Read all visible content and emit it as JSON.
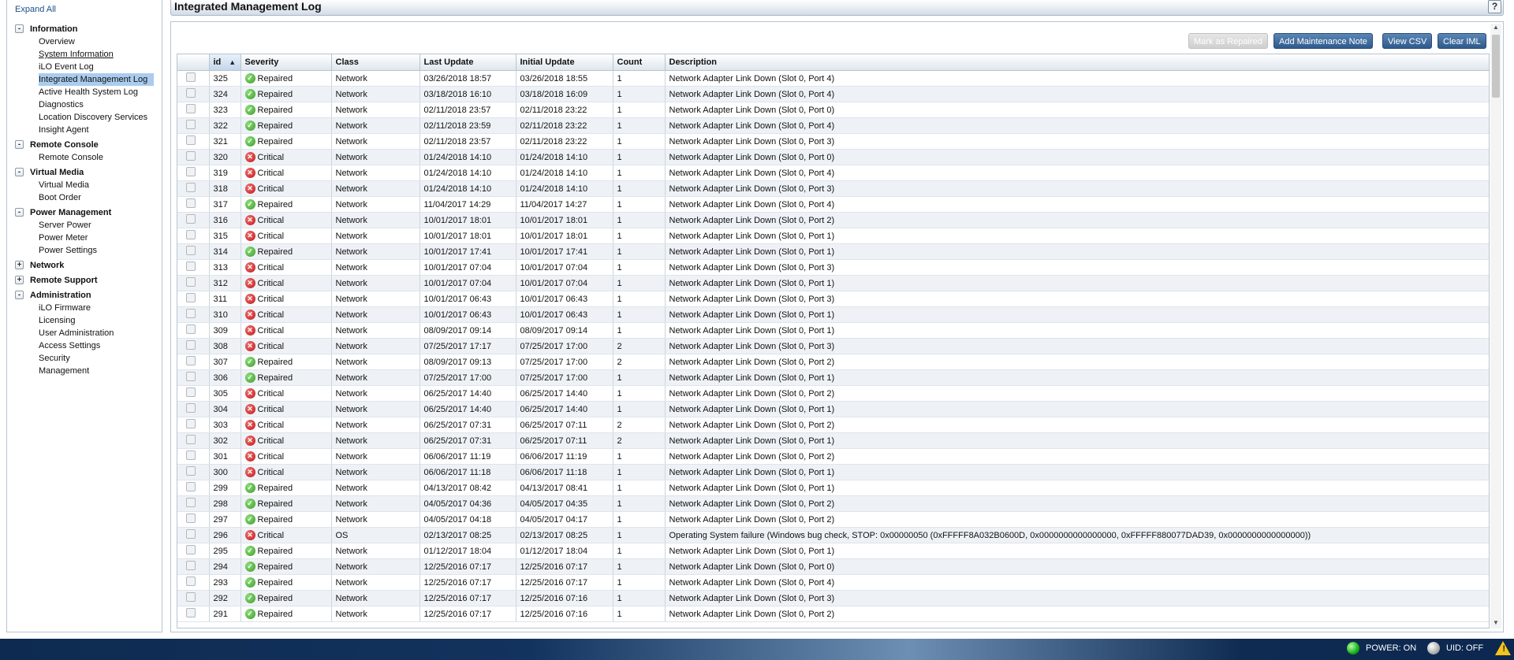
{
  "sidebar": {
    "expand_all": "Expand All",
    "sections": [
      {
        "label": "Information",
        "toggle": "-",
        "items": [
          "Overview",
          "System Information",
          "iLO Event Log",
          "Integrated Management Log",
          "Active Health System Log",
          "Diagnostics",
          "Location Discovery Services",
          "Insight Agent"
        ]
      },
      {
        "label": "Remote Console",
        "toggle": "-",
        "items": [
          "Remote Console"
        ]
      },
      {
        "label": "Virtual Media",
        "toggle": "-",
        "items": [
          "Virtual Media",
          "Boot Order"
        ]
      },
      {
        "label": "Power Management",
        "toggle": "-",
        "items": [
          "Server Power",
          "Power Meter",
          "Power Settings"
        ]
      },
      {
        "label": "Network",
        "toggle": "+",
        "items": []
      },
      {
        "label": "Remote Support",
        "toggle": "+",
        "items": []
      },
      {
        "label": "Administration",
        "toggle": "-",
        "items": [
          "iLO Firmware",
          "Licensing",
          "User Administration",
          "Access Settings",
          "Security",
          "Management"
        ]
      }
    ],
    "active_item": "Integrated Management Log",
    "underlined_item": "System Information"
  },
  "header": {
    "title": "Integrated Management Log",
    "help": "?"
  },
  "toolbar": {
    "mark_repaired": "Mark as Repaired",
    "add_note": "Add Maintenance Note",
    "view_csv": "View CSV",
    "clear_iml": "Clear IML"
  },
  "table": {
    "columns": [
      "id",
      "Severity",
      "Class",
      "Last Update",
      "Initial Update",
      "Count",
      "Description"
    ],
    "sorted_column": "id",
    "rows": [
      [
        "325",
        "Repaired",
        "Network",
        "03/26/2018 18:57",
        "03/26/2018 18:55",
        "1",
        "Network Adapter Link Down (Slot 0, Port 4)"
      ],
      [
        "324",
        "Repaired",
        "Network",
        "03/18/2018 16:10",
        "03/18/2018 16:09",
        "1",
        "Network Adapter Link Down (Slot 0, Port 4)"
      ],
      [
        "323",
        "Repaired",
        "Network",
        "02/11/2018 23:57",
        "02/11/2018 23:22",
        "1",
        "Network Adapter Link Down (Slot 0, Port 0)"
      ],
      [
        "322",
        "Repaired",
        "Network",
        "02/11/2018 23:59",
        "02/11/2018 23:22",
        "1",
        "Network Adapter Link Down (Slot 0, Port 4)"
      ],
      [
        "321",
        "Repaired",
        "Network",
        "02/11/2018 23:57",
        "02/11/2018 23:22",
        "1",
        "Network Adapter Link Down (Slot 0, Port 3)"
      ],
      [
        "320",
        "Critical",
        "Network",
        "01/24/2018 14:10",
        "01/24/2018 14:10",
        "1",
        "Network Adapter Link Down (Slot 0, Port 0)"
      ],
      [
        "319",
        "Critical",
        "Network",
        "01/24/2018 14:10",
        "01/24/2018 14:10",
        "1",
        "Network Adapter Link Down (Slot 0, Port 4)"
      ],
      [
        "318",
        "Critical",
        "Network",
        "01/24/2018 14:10",
        "01/24/2018 14:10",
        "1",
        "Network Adapter Link Down (Slot 0, Port 3)"
      ],
      [
        "317",
        "Repaired",
        "Network",
        "11/04/2017 14:29",
        "11/04/2017 14:27",
        "1",
        "Network Adapter Link Down (Slot 0, Port 4)"
      ],
      [
        "316",
        "Critical",
        "Network",
        "10/01/2017 18:01",
        "10/01/2017 18:01",
        "1",
        "Network Adapter Link Down (Slot 0, Port 2)"
      ],
      [
        "315",
        "Critical",
        "Network",
        "10/01/2017 18:01",
        "10/01/2017 18:01",
        "1",
        "Network Adapter Link Down (Slot 0, Port 1)"
      ],
      [
        "314",
        "Repaired",
        "Network",
        "10/01/2017 17:41",
        "10/01/2017 17:41",
        "1",
        "Network Adapter Link Down (Slot 0, Port 1)"
      ],
      [
        "313",
        "Critical",
        "Network",
        "10/01/2017 07:04",
        "10/01/2017 07:04",
        "1",
        "Network Adapter Link Down (Slot 0, Port 3)"
      ],
      [
        "312",
        "Critical",
        "Network",
        "10/01/2017 07:04",
        "10/01/2017 07:04",
        "1",
        "Network Adapter Link Down (Slot 0, Port 1)"
      ],
      [
        "311",
        "Critical",
        "Network",
        "10/01/2017 06:43",
        "10/01/2017 06:43",
        "1",
        "Network Adapter Link Down (Slot 0, Port 3)"
      ],
      [
        "310",
        "Critical",
        "Network",
        "10/01/2017 06:43",
        "10/01/2017 06:43",
        "1",
        "Network Adapter Link Down (Slot 0, Port 1)"
      ],
      [
        "309",
        "Critical",
        "Network",
        "08/09/2017 09:14",
        "08/09/2017 09:14",
        "1",
        "Network Adapter Link Down (Slot 0, Port 1)"
      ],
      [
        "308",
        "Critical",
        "Network",
        "07/25/2017 17:17",
        "07/25/2017 17:00",
        "2",
        "Network Adapter Link Down (Slot 0, Port 3)"
      ],
      [
        "307",
        "Repaired",
        "Network",
        "08/09/2017 09:13",
        "07/25/2017 17:00",
        "2",
        "Network Adapter Link Down (Slot 0, Port 2)"
      ],
      [
        "306",
        "Repaired",
        "Network",
        "07/25/2017 17:00",
        "07/25/2017 17:00",
        "1",
        "Network Adapter Link Down (Slot 0, Port 1)"
      ],
      [
        "305",
        "Critical",
        "Network",
        "06/25/2017 14:40",
        "06/25/2017 14:40",
        "1",
        "Network Adapter Link Down (Slot 0, Port 2)"
      ],
      [
        "304",
        "Critical",
        "Network",
        "06/25/2017 14:40",
        "06/25/2017 14:40",
        "1",
        "Network Adapter Link Down (Slot 0, Port 1)"
      ],
      [
        "303",
        "Critical",
        "Network",
        "06/25/2017 07:31",
        "06/25/2017 07:11",
        "2",
        "Network Adapter Link Down (Slot 0, Port 2)"
      ],
      [
        "302",
        "Critical",
        "Network",
        "06/25/2017 07:31",
        "06/25/2017 07:11",
        "2",
        "Network Adapter Link Down (Slot 0, Port 1)"
      ],
      [
        "301",
        "Critical",
        "Network",
        "06/06/2017 11:19",
        "06/06/2017 11:19",
        "1",
        "Network Adapter Link Down (Slot 0, Port 2)"
      ],
      [
        "300",
        "Critical",
        "Network",
        "06/06/2017 11:18",
        "06/06/2017 11:18",
        "1",
        "Network Adapter Link Down (Slot 0, Port 1)"
      ],
      [
        "299",
        "Repaired",
        "Network",
        "04/13/2017 08:42",
        "04/13/2017 08:41",
        "1",
        "Network Adapter Link Down (Slot 0, Port 1)"
      ],
      [
        "298",
        "Repaired",
        "Network",
        "04/05/2017 04:36",
        "04/05/2017 04:35",
        "1",
        "Network Adapter Link Down (Slot 0, Port 2)"
      ],
      [
        "297",
        "Repaired",
        "Network",
        "04/05/2017 04:18",
        "04/05/2017 04:17",
        "1",
        "Network Adapter Link Down (Slot 0, Port 2)"
      ],
      [
        "296",
        "Critical",
        "OS",
        "02/13/2017 08:25",
        "02/13/2017 08:25",
        "1",
        "Operating System failure (Windows bug check, STOP: 0x00000050 (0xFFFFF8A032B0600D, 0x0000000000000000, 0xFFFFF880077DAD39, 0x0000000000000000))"
      ],
      [
        "295",
        "Repaired",
        "Network",
        "01/12/2017 18:04",
        "01/12/2017 18:04",
        "1",
        "Network Adapter Link Down (Slot 0, Port 1)"
      ],
      [
        "294",
        "Repaired",
        "Network",
        "12/25/2016 07:17",
        "12/25/2016 07:17",
        "1",
        "Network Adapter Link Down (Slot 0, Port 0)"
      ],
      [
        "293",
        "Repaired",
        "Network",
        "12/25/2016 07:17",
        "12/25/2016 07:17",
        "1",
        "Network Adapter Link Down (Slot 0, Port 4)"
      ],
      [
        "292",
        "Repaired",
        "Network",
        "12/25/2016 07:17",
        "12/25/2016 07:16",
        "1",
        "Network Adapter Link Down (Slot 0, Port 3)"
      ],
      [
        "291",
        "Repaired",
        "Network",
        "12/25/2016 07:17",
        "12/25/2016 07:16",
        "1",
        "Network Adapter Link Down (Slot 0, Port 2)"
      ]
    ]
  },
  "footer": {
    "power": "POWER: ON",
    "uid": "UID: OFF"
  },
  "colors": {
    "repaired": "#3a9a2a",
    "critical": "#c01818",
    "nav_active": "#aaccee",
    "button": "#2e5a8c"
  }
}
